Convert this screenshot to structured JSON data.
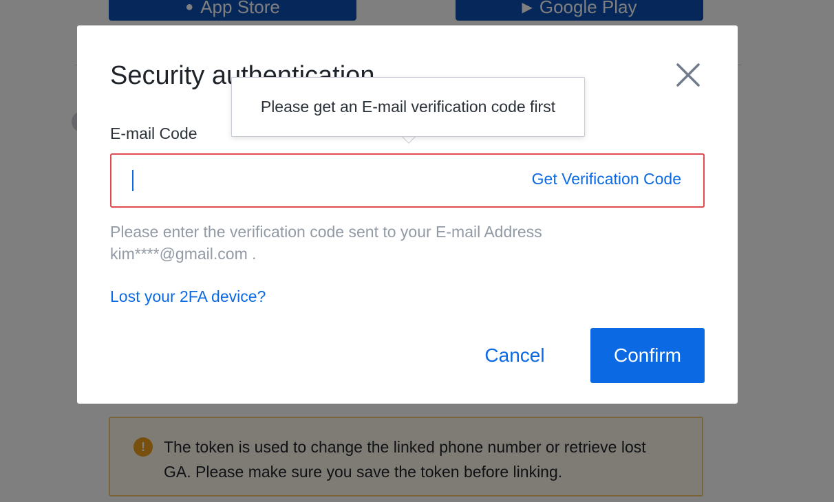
{
  "background": {
    "store_buttons": [
      {
        "label": "App Store",
        "icon": "apple-icon"
      },
      {
        "label": "Google Play",
        "icon": "play-icon"
      }
    ],
    "notice": {
      "icon": "warning-icon",
      "text": "The token is used to change the linked phone number or retrieve lost GA. Please make sure you save the token before linking."
    }
  },
  "modal": {
    "title": "Security authentication",
    "close_icon": "close-icon",
    "field_label": "E-mail Code",
    "input_value": "",
    "get_code_label": "Get Verification Code",
    "hint_line1": "Please enter the verification code sent to your E-mail Address",
    "hint_line2": "kim****@gmail.com .",
    "lost_device_link": "Lost your 2FA device?",
    "cancel_label": "Cancel",
    "confirm_label": "Confirm"
  },
  "tooltip": {
    "text": "Please get an E-mail verification code first"
  },
  "colors": {
    "accent": "#0b6ae3",
    "error_border": "#e04a4f",
    "overlay": "rgba(0,0,0,0.5)",
    "warning": "#f0a11c"
  }
}
